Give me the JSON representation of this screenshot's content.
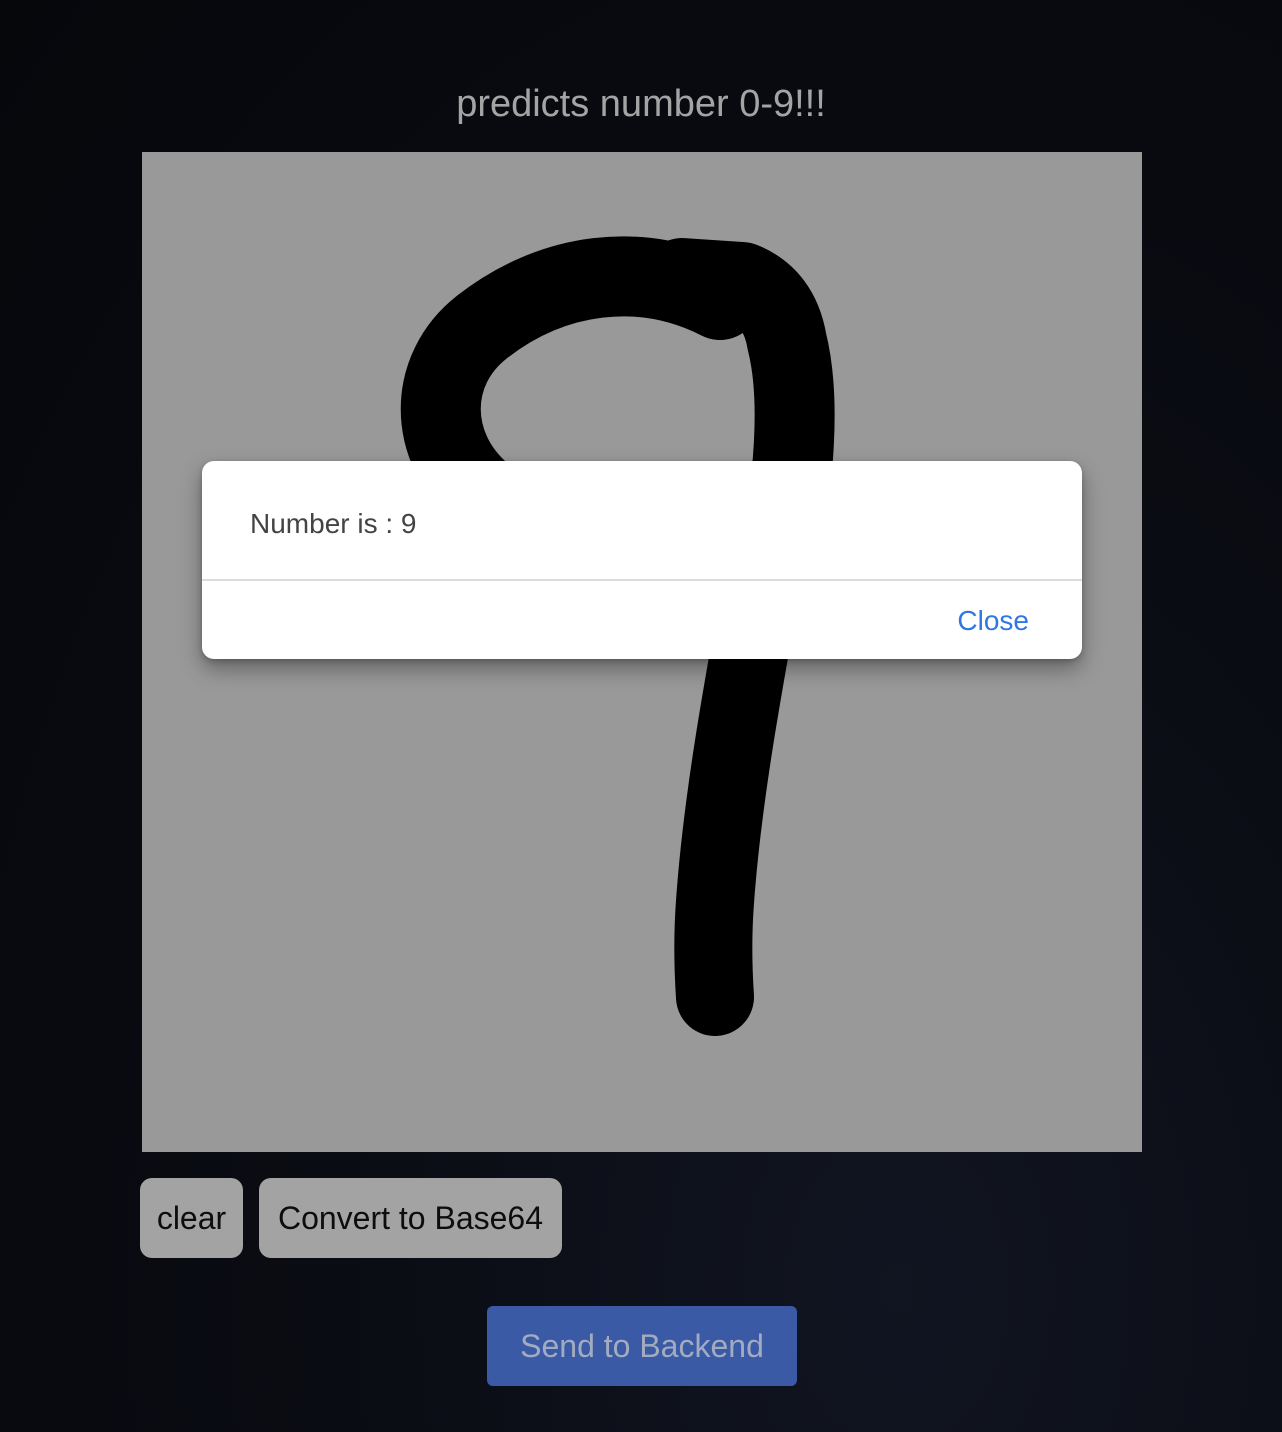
{
  "header": {
    "title": "predicts number 0-9!!!"
  },
  "canvas": {
    "background": "#999999",
    "stroke_color": "#000000"
  },
  "controls": {
    "clear_label": "clear",
    "convert_label": "Convert to Base64",
    "send_label": "Send to Backend"
  },
  "dialog": {
    "message": "Number is : 9",
    "close_label": "Close"
  },
  "colors": {
    "accent": "#3a5aa6",
    "link": "#2f77e6"
  }
}
